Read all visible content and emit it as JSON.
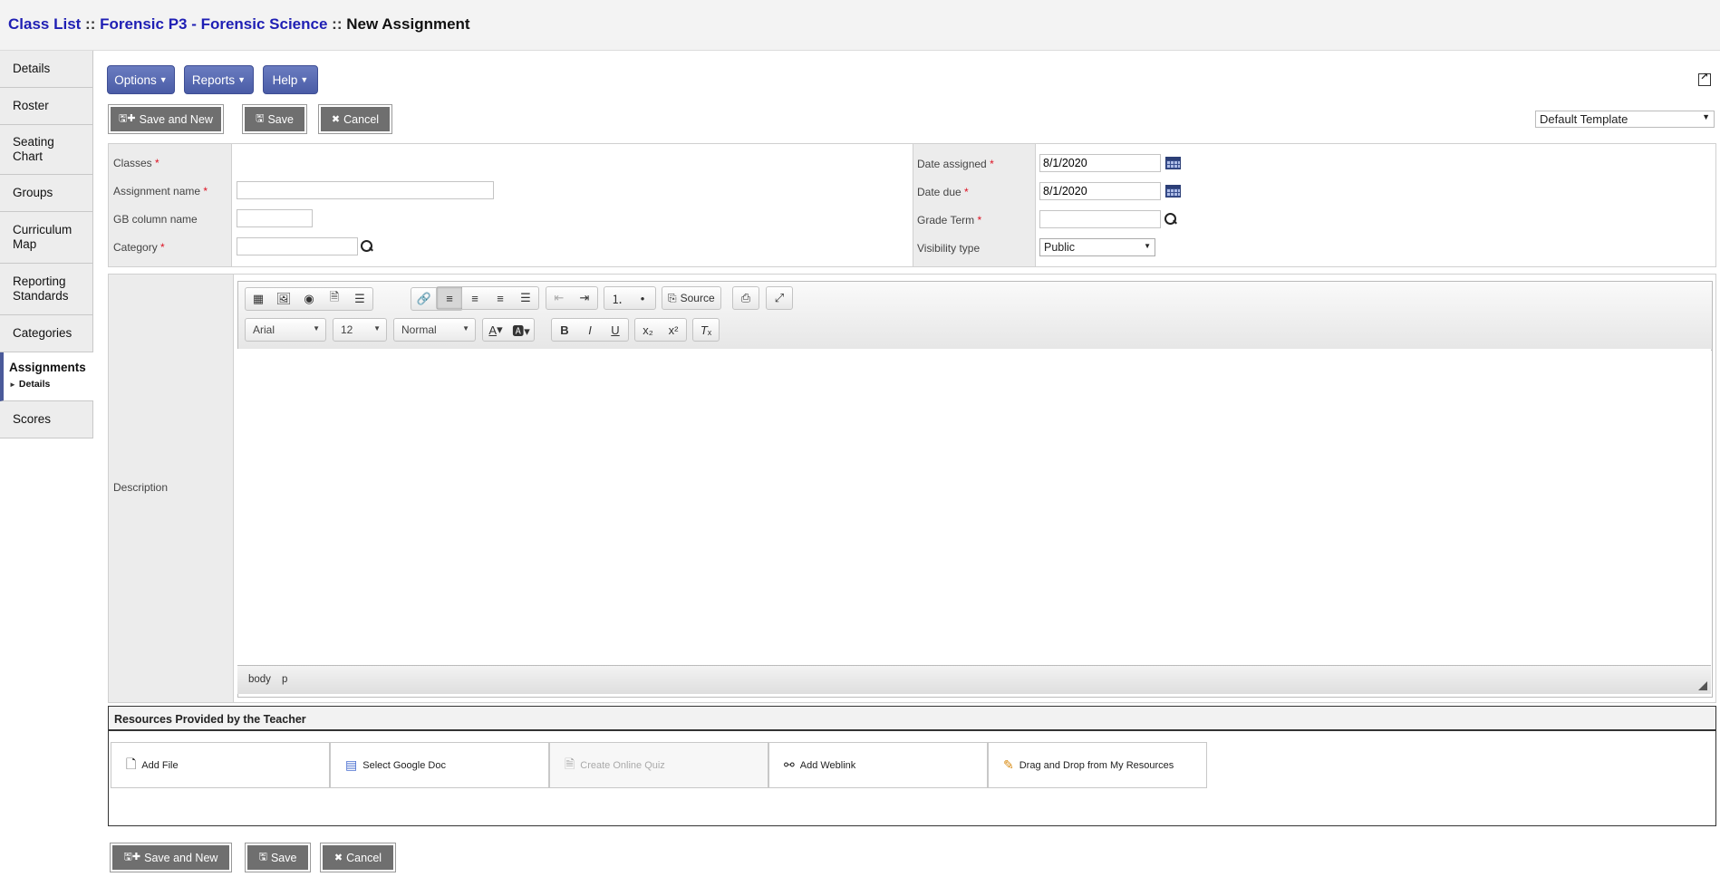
{
  "breadcrumb": {
    "class_list": "Class List",
    "sep1": "::",
    "course": "Forensic P3 - Forensic Science",
    "sep2": "::",
    "current": "New Assignment"
  },
  "sidebar": {
    "items": [
      {
        "label": "Details"
      },
      {
        "label": "Roster"
      },
      {
        "label": "Seating Chart"
      },
      {
        "label": "Groups"
      },
      {
        "label": "Curriculum Map"
      },
      {
        "label": "Reporting Standards"
      },
      {
        "label": "Categories"
      },
      {
        "label": "Assignments",
        "sub": "Details"
      },
      {
        "label": "Scores"
      }
    ]
  },
  "nav": {
    "options": "Options",
    "reports": "Reports",
    "help": "Help"
  },
  "actions": {
    "save_and_new": "Save and New",
    "save": "Save",
    "cancel": "Cancel"
  },
  "template": {
    "selected": "Default Template"
  },
  "form": {
    "classes_label": "Classes",
    "assignment_name_label": "Assignment name",
    "gb_column_label": "GB column name",
    "category_label": "Category",
    "date_assigned_label": "Date assigned",
    "date_assigned_value": "8/1/2020",
    "date_due_label": "Date due",
    "date_due_value": "8/1/2020",
    "grade_term_label": "Grade Term",
    "visibility_label": "Visibility type",
    "visibility_value": "Public",
    "required_mark": "*"
  },
  "description": {
    "label": "Description",
    "font": "Arial",
    "size": "12",
    "format": "Normal",
    "source_label": "Source",
    "status_path": [
      "body",
      "p"
    ]
  },
  "resources": {
    "header": "Resources Provided by the Teacher",
    "buttons": [
      {
        "label": "Add File",
        "icon": "add-file-icon"
      },
      {
        "label": "Select Google Doc",
        "icon": "google-doc-icon"
      },
      {
        "label": "Create Online Quiz",
        "icon": "quiz-icon"
      },
      {
        "label": "Add Weblink",
        "icon": "weblink-icon"
      },
      {
        "label": "Drag and Drop from My Resources",
        "icon": "resources-icon"
      }
    ]
  }
}
